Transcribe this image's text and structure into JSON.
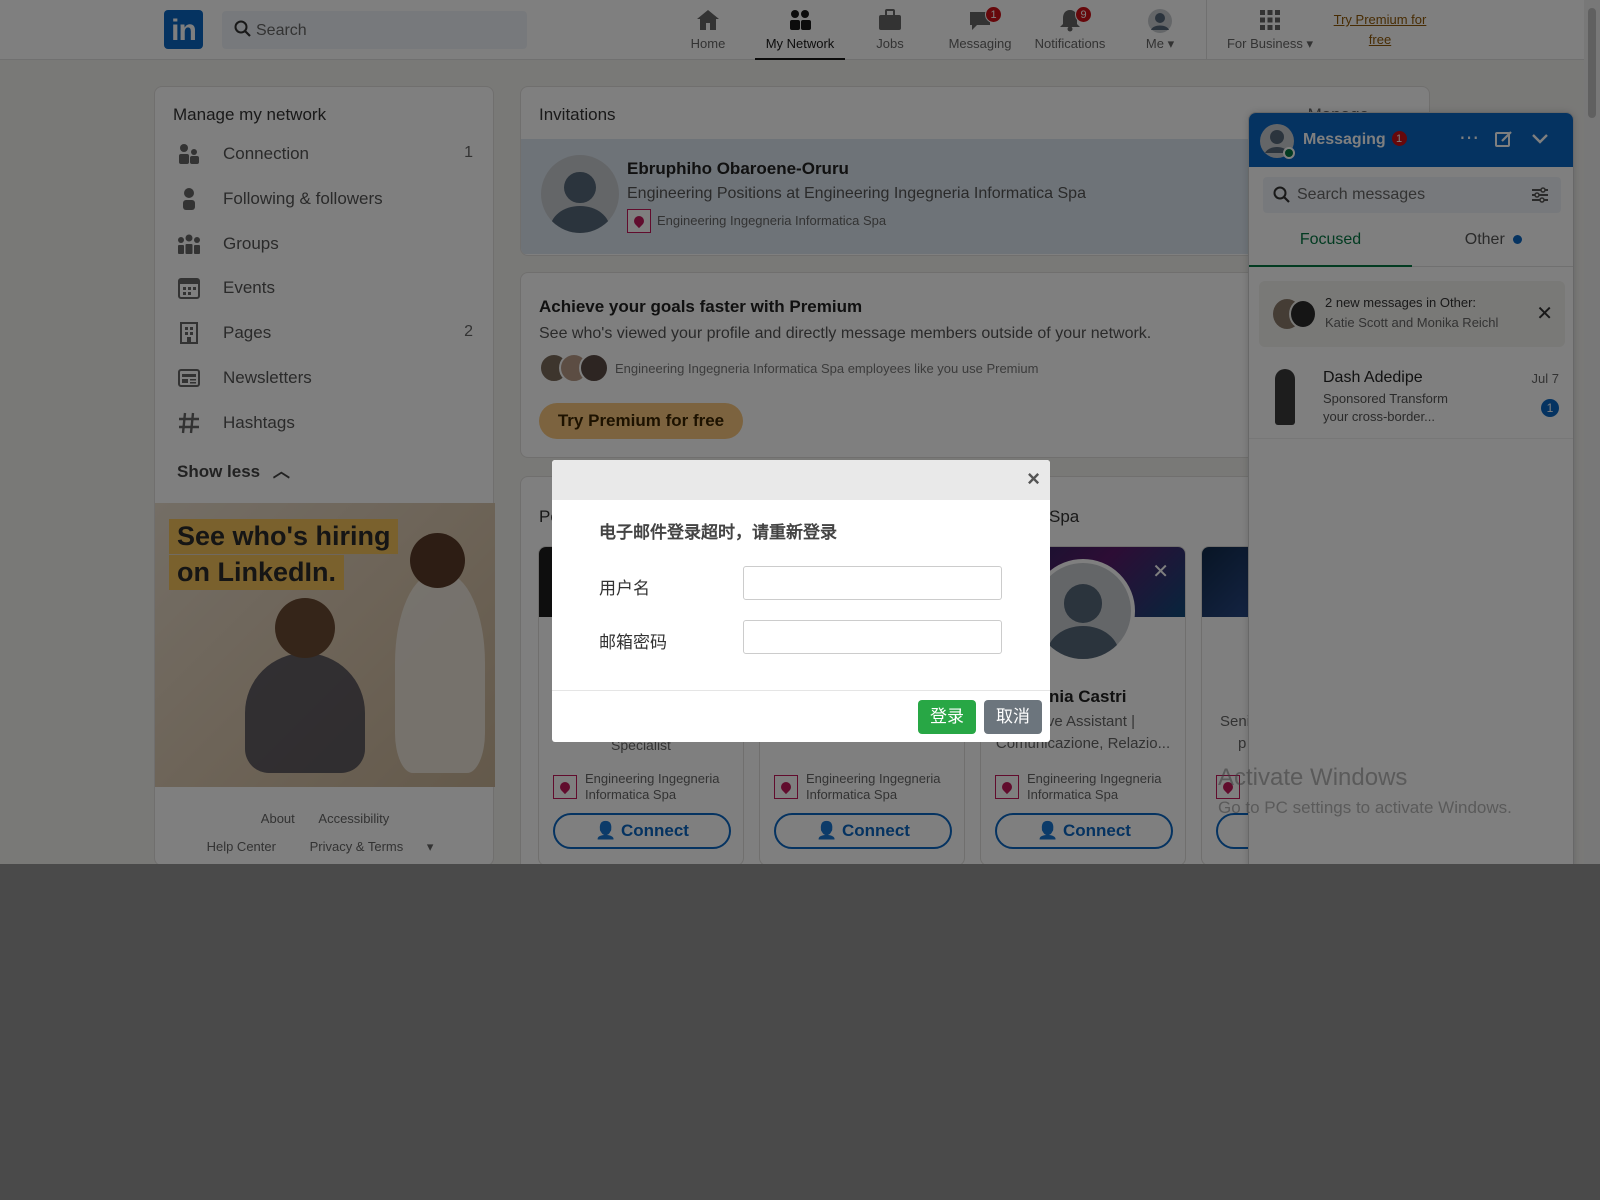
{
  "nav": {
    "search_placeholder": "Search",
    "items": [
      {
        "label": "Home",
        "icon": "home-icon"
      },
      {
        "label": "My Network",
        "icon": "network-icon",
        "active": true
      },
      {
        "label": "Jobs",
        "icon": "briefcase-icon"
      },
      {
        "label": "Messaging",
        "icon": "messaging-icon",
        "badge": "1"
      },
      {
        "label": "Notifications",
        "icon": "bell-icon",
        "badge": "9"
      },
      {
        "label": "Me",
        "icon": "avatar-icon"
      }
    ],
    "business_label": "For Business",
    "premium_line1": "Try Premium for",
    "premium_line2": "free"
  },
  "sidebar": {
    "title": "Manage my network",
    "items": [
      {
        "label": "Connection",
        "count": "1"
      },
      {
        "label": "Following & followers",
        "count": ""
      },
      {
        "label": "Groups",
        "count": ""
      },
      {
        "label": "Events",
        "count": ""
      },
      {
        "label": "Pages",
        "count": "2"
      },
      {
        "label": "Newsletters",
        "count": ""
      },
      {
        "label": "Hashtags",
        "count": ""
      }
    ],
    "show_less": "Show less",
    "ad_line1": "See who's hiring",
    "ad_line2": "on LinkedIn.",
    "footer1": [
      "About",
      "Accessibility"
    ],
    "footer2": [
      "Help Center",
      "Privacy & Terms"
    ]
  },
  "invitations": {
    "title": "Invitations",
    "right_label": "Manage",
    "name": "Ebruphiho Obaroene-Oruru",
    "headline": "Engineering Positions at Engineering Ingegneria Informatica Spa",
    "company": "Engineering Ingegneria Informatica Spa"
  },
  "premium": {
    "title": "Achieve your goals faster with Premium",
    "desc": "See who's viewed your profile and directly message members outside of your network.",
    "sub": "Engineering Ingegneria Informatica Spa employees like you use Premium",
    "button": "Try Premium for free"
  },
  "people": {
    "section_prefix": "Pe",
    "section_suffix": "Spa",
    "cards": [
      {
        "name": "",
        "headline1": "Specialist",
        "headline2": "",
        "company1": "Engineering Ingegneria",
        "company2": "Informatica Spa",
        "connect": "Connect"
      },
      {
        "name": "",
        "headline1": "",
        "headline2": "",
        "company1": "Engineering Ingegneria",
        "company2": "Informatica Spa",
        "connect": "Connect"
      },
      {
        "name": "enia Castri",
        "headline1": "utive Assistant |",
        "headline2": "Comunicazione, Relazio...",
        "company1": "Engineering Ingegneria",
        "company2": "Informatica Spa",
        "connect": "Connect"
      },
      {
        "name": "",
        "headline1": "Seni",
        "headline2": "p",
        "company1": "",
        "company2": "",
        "connect": ""
      }
    ]
  },
  "messaging": {
    "title": "Messaging",
    "badge": "1",
    "search_placeholder": "Search messages",
    "tabs": [
      "Focused",
      "Other"
    ],
    "notice_line1": "2 new messages in Other:",
    "notice_line2": "Katie Scott and Monika Reichl",
    "conversation": {
      "name": "Dash Adedipe",
      "date": "Jul 7",
      "line1": "Sponsored  Transform",
      "line2": "your cross-border...",
      "count": "1"
    }
  },
  "watermark": {
    "line1": "Activate Windows",
    "line2": "Go to PC settings to activate Windows."
  },
  "modal": {
    "message": "电子邮件登录超时，请重新登录",
    "username_label": "用户名",
    "password_label": "邮箱密码",
    "username_value": "",
    "password_value": "",
    "login_button": "登录",
    "cancel_button": "取消",
    "close": "×"
  },
  "colors": {
    "linkedin_blue": "#0a66c2",
    "login_green": "#28a745",
    "cancel_gray": "#6c757d",
    "premium_gold": "#f8c77e",
    "focused_green": "#057642"
  }
}
